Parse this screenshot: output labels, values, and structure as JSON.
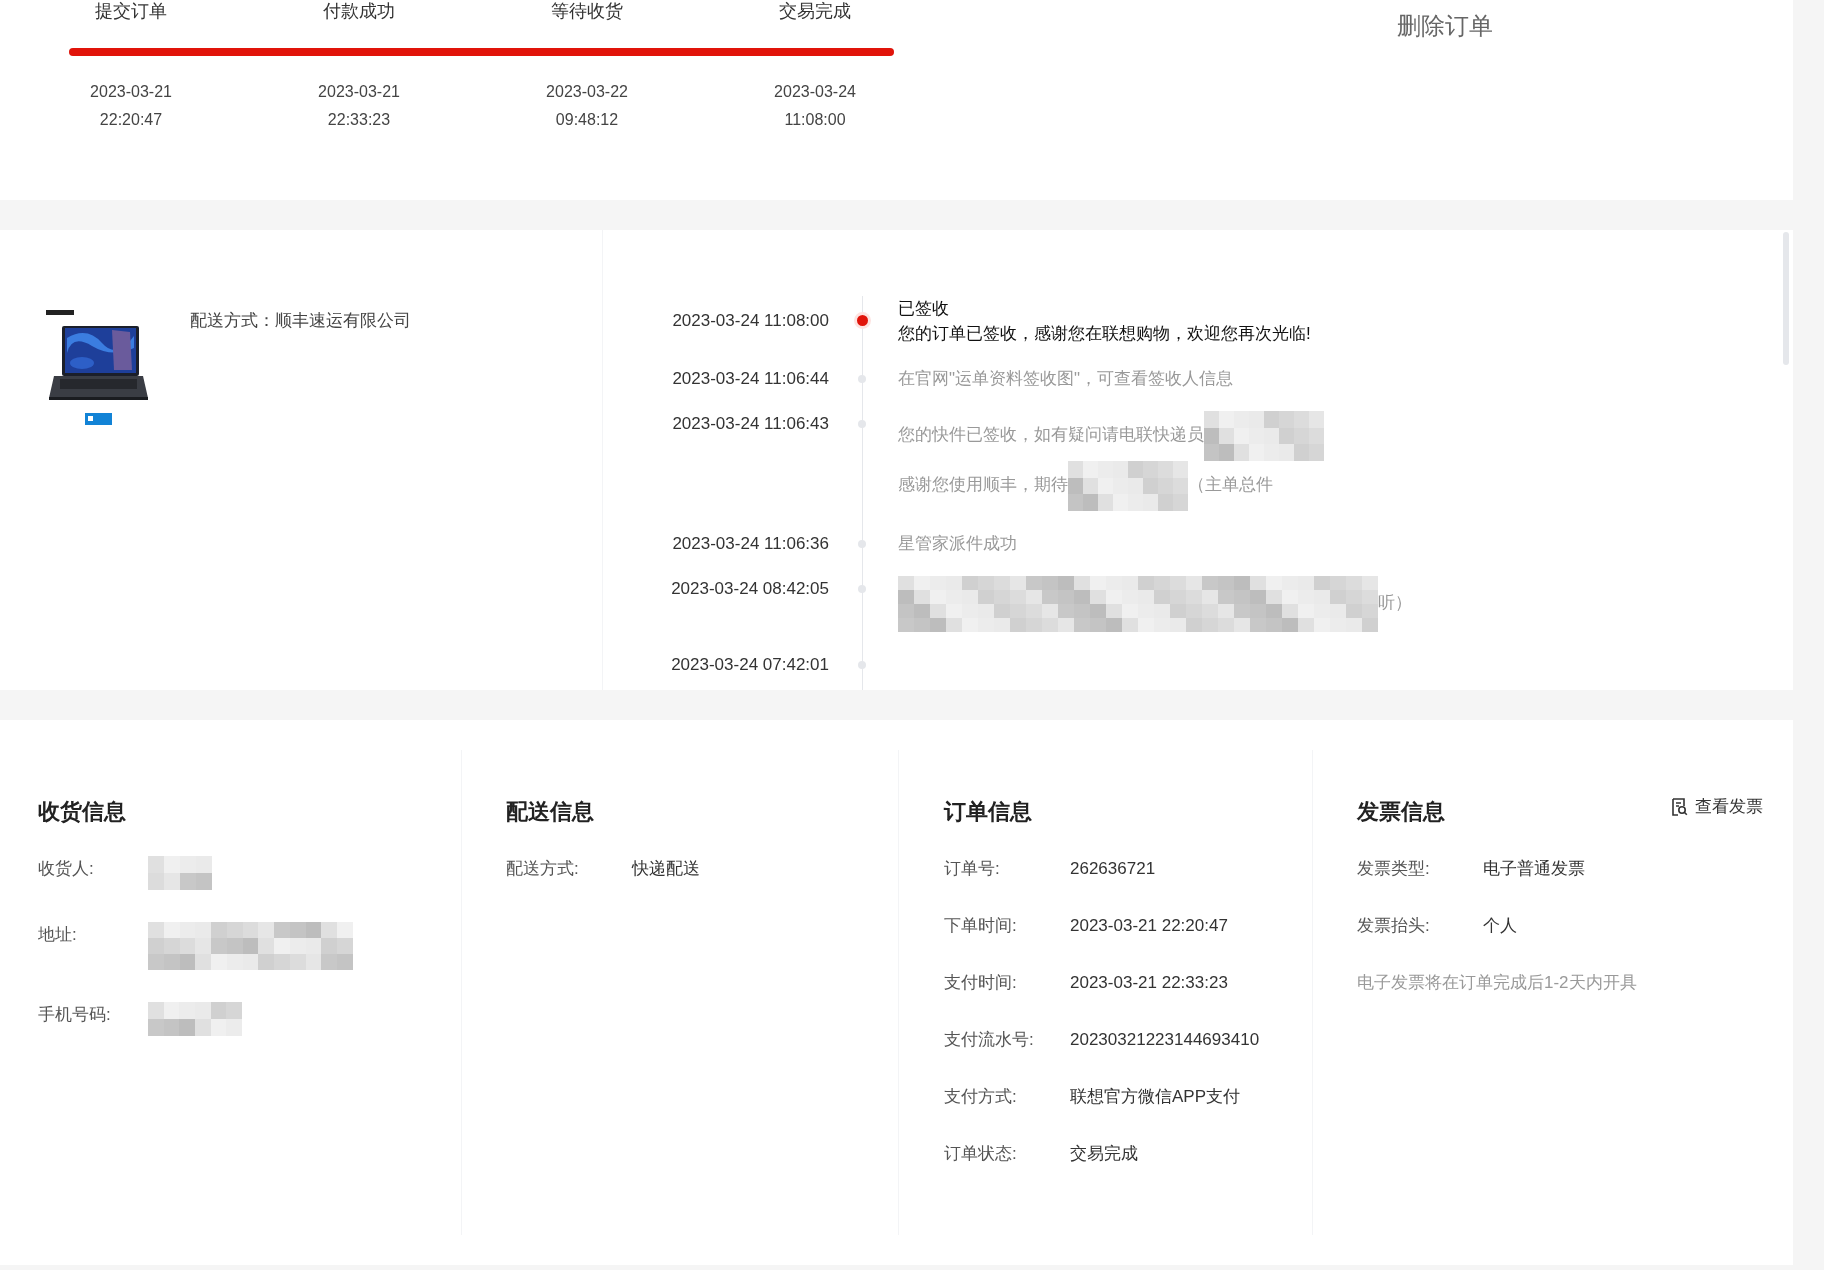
{
  "progress": {
    "level": 1,
    "steps": [
      {
        "label": "提交订单",
        "date": "2023-03-21",
        "time": "22:20:47"
      },
      {
        "label": "付款成功",
        "date": "2023-03-21",
        "time": "22:33:23"
      },
      {
        "label": "等待收货",
        "date": "2023-03-22",
        "time": "09:48:12"
      },
      {
        "label": "交易完成",
        "date": "2023-03-24",
        "time": "11:08:00"
      }
    ]
  },
  "delete_button": "删除订单",
  "product": {
    "delivery": "配送方式：顺丰速运有限公司"
  },
  "tracking": [
    {
      "time": "2023-03-24 11:08:00",
      "current": true,
      "title": "已签收",
      "segments": [
        {
          "kind": "text",
          "text": "您的订单已签收，感谢您在联想购物，欢迎您再次光临!"
        }
      ]
    },
    {
      "time": "2023-03-24 11:06:44",
      "current": false,
      "segments": [
        {
          "kind": "text",
          "text": "在官网\"运单资料签收图\"，可查看签收人信息"
        }
      ]
    },
    {
      "time": "2023-03-24 11:06:43",
      "current": false,
      "segments": [
        {
          "kind": "text",
          "text": "您的快件已签收，如有疑问请电联快递员"
        },
        {
          "kind": "redacted"
        },
        {
          "kind": "text",
          "text": "感谢您使用顺丰，期待"
        },
        {
          "kind": "redacted"
        },
        {
          "kind": "text",
          "text": "（主单总件"
        }
      ]
    },
    {
      "time": "2023-03-24 11:06:36",
      "current": false,
      "segments": [
        {
          "kind": "text",
          "text": "星管家派件成功"
        }
      ]
    },
    {
      "time": "2023-03-24 08:42:05",
      "current": false,
      "segments": [
        {
          "kind": "redacted"
        },
        {
          "kind": "text",
          "text": "听）"
        }
      ]
    },
    {
      "time": "2023-03-24 07:42:01",
      "current": false
    }
  ],
  "info_sections": [
    {
      "title": "收货信息",
      "fields": [
        {
          "label": "收货人:",
          "kind": "redacted"
        },
        {
          "label": "地址:",
          "kind": "redacted"
        },
        {
          "label": "手机号码:",
          "kind": "redacted"
        }
      ]
    },
    {
      "title": "配送信息",
      "fields": [
        {
          "label": "配送方式:",
          "kind": "text",
          "value": "快递配送"
        }
      ]
    },
    {
      "title": "订单信息",
      "fields": [
        {
          "label": "订单号:",
          "kind": "text",
          "value": "262636721"
        },
        {
          "label": "下单时间:",
          "kind": "text",
          "value": "2023-03-21 22:20:47"
        },
        {
          "label": "支付时间:",
          "kind": "text",
          "value": "2023-03-21 22:33:23"
        },
        {
          "label": "支付流水号:",
          "kind": "text",
          "value": "20230321223144693410"
        },
        {
          "label": "支付方式:",
          "kind": "text",
          "value": "联想官方微信APP支付"
        },
        {
          "label": "订单状态:",
          "kind": "text",
          "value": "交易完成"
        }
      ]
    },
    {
      "title": "发票信息",
      "link": "查看发票",
      "fields": [
        {
          "label": "发票类型:",
          "kind": "text",
          "value": "电子普通发票"
        },
        {
          "label": "发票抬头:",
          "kind": "text",
          "value": "个人"
        }
      ],
      "note": "电子发票将在订单完成后1-2天内开具"
    }
  ]
}
